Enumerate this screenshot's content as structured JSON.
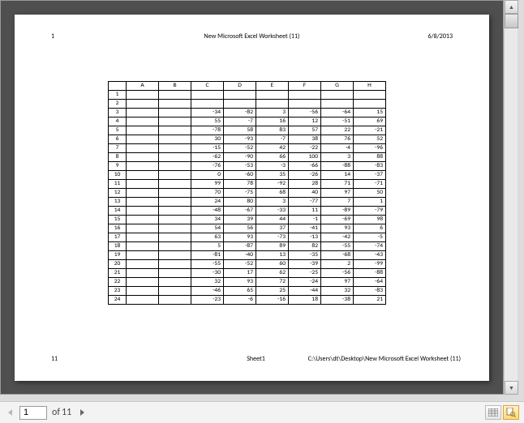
{
  "header": {
    "page_number": "1",
    "title": "New Microsoft Excel Worksheet (11)",
    "date": "6/8/2013"
  },
  "footer": {
    "sheet_no": "11",
    "sheet_name": "Sheet1",
    "path": "C:\\Users\\dt\\Desktop\\New Microsoft Excel Worksheet (11)"
  },
  "nav": {
    "current_page": "1",
    "of_label": "of",
    "total_pages": "11"
  },
  "chart_data": {
    "type": "table",
    "columns": [
      "A",
      "B",
      "C",
      "D",
      "E",
      "F",
      "G",
      "H"
    ],
    "row_labels": [
      "1",
      "2",
      "3",
      "4",
      "5",
      "6",
      "7",
      "8",
      "9",
      "10",
      "11",
      "12",
      "13",
      "14",
      "15",
      "16",
      "17",
      "18",
      "19",
      "20",
      "21",
      "22",
      "23",
      "24"
    ],
    "rows": [
      [
        "",
        "",
        "",
        "",
        "",
        "",
        "",
        ""
      ],
      [
        "",
        "",
        "",
        "",
        "",
        "",
        "",
        ""
      ],
      [
        "",
        "",
        "-34",
        "-82",
        "3",
        "-56",
        "-64",
        "15"
      ],
      [
        "",
        "",
        "55",
        "-7",
        "16",
        "12",
        "-51",
        "69"
      ],
      [
        "",
        "",
        "-78",
        "58",
        "83",
        "57",
        "22",
        "-21"
      ],
      [
        "",
        "",
        "30",
        "-93",
        "-7",
        "38",
        "76",
        "52"
      ],
      [
        "",
        "",
        "-15",
        "-52",
        "42",
        "-22",
        "-4",
        "-96"
      ],
      [
        "",
        "",
        "-62",
        "-90",
        "66",
        "100",
        "3",
        "88"
      ],
      [
        "",
        "",
        "-76",
        "-53",
        "-3",
        "-66",
        "-88",
        "-83"
      ],
      [
        "",
        "",
        "0",
        "-60",
        "35",
        "-26",
        "14",
        "-37"
      ],
      [
        "",
        "",
        "99",
        "78",
        "-92",
        "28",
        "71",
        "-71"
      ],
      [
        "",
        "",
        "70",
        "-75",
        "68",
        "40",
        "97",
        "50"
      ],
      [
        "",
        "",
        "24",
        "80",
        "3",
        "-77",
        "7",
        "1"
      ],
      [
        "",
        "",
        "-48",
        "-67",
        "-33",
        "11",
        "-89",
        "-79"
      ],
      [
        "",
        "",
        "34",
        "39",
        "44",
        "-1",
        "-69",
        "98"
      ],
      [
        "",
        "",
        "54",
        "56",
        "37",
        "-41",
        "93",
        "6"
      ],
      [
        "",
        "",
        "63",
        "93",
        "-73",
        "-13",
        "-42",
        "-5"
      ],
      [
        "",
        "",
        "5",
        "-87",
        "89",
        "82",
        "-55",
        "-74"
      ],
      [
        "",
        "",
        "-81",
        "-40",
        "13",
        "-35",
        "-68",
        "-43"
      ],
      [
        "",
        "",
        "-55",
        "-52",
        "60",
        "-39",
        "2",
        "-99"
      ],
      [
        "",
        "",
        "-30",
        "17",
        "62",
        "-25",
        "-56",
        "-88"
      ],
      [
        "",
        "",
        "32",
        "93",
        "72",
        "-24",
        "97",
        "-64"
      ],
      [
        "",
        "",
        "-46",
        "65",
        "25",
        "-44",
        "32",
        "-83"
      ],
      [
        "",
        "",
        "-23",
        "-6",
        "-16",
        "18",
        "-38",
        "21"
      ]
    ]
  }
}
